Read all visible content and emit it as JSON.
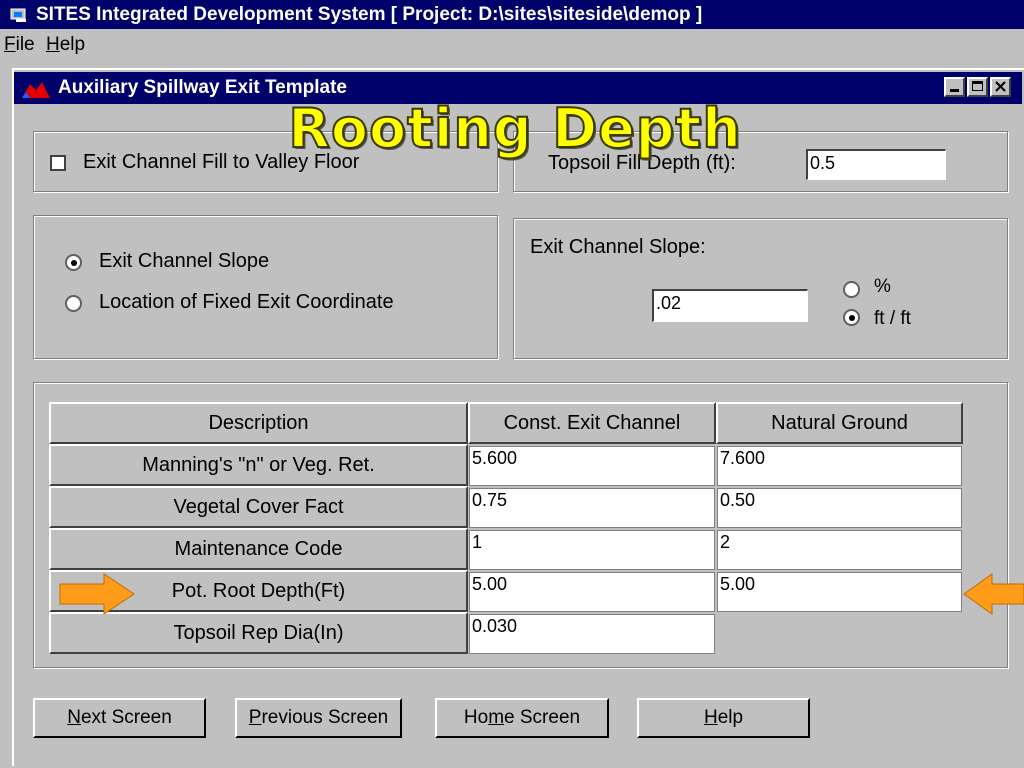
{
  "app": {
    "title": "SITES Integrated Development System [ Project: D:\\sites\\siteside\\demop ]"
  },
  "menu": [
    {
      "label": "File",
      "mnemonic": "F",
      "rest": "ile"
    },
    {
      "label": "Help",
      "mnemonic": "H",
      "rest": "elp"
    }
  ],
  "window": {
    "title": "Auxiliary Spillway Exit Template",
    "controls": [
      "minimize",
      "maximize",
      "close"
    ]
  },
  "overlay": {
    "heading": "Rooting Depth",
    "color": "#ffff00",
    "arrow_color": "#ff9c1a"
  },
  "fill_section": {
    "checkbox_label": "Exit Channel Fill to Valley Floor",
    "checked": false,
    "topsoil_label": "Topsoil Fill Depth (ft):",
    "topsoil_value": "0.5"
  },
  "slope_options": {
    "options": [
      "Exit Channel Slope",
      "Location of Fixed Exit Coordinate"
    ],
    "selected": "Exit Channel Slope"
  },
  "slope_section": {
    "label": "Exit Channel Slope:",
    "value": ".02",
    "units": [
      "%",
      "ft / ft"
    ],
    "selected_unit": "ft / ft"
  },
  "table": {
    "headers": [
      "Description",
      "Const. Exit Channel",
      "Natural Ground"
    ],
    "rows": [
      {
        "description": "Manning's \"n\" or Veg. Ret.",
        "const": "5.600",
        "natural": "7.600"
      },
      {
        "description": "Vegetal Cover Fact",
        "const": "0.75",
        "natural": "0.50"
      },
      {
        "description": "Maintenance Code",
        "const": "1",
        "natural": "2"
      },
      {
        "description": "Pot. Root Depth(Ft)",
        "const": "5.00",
        "natural": "5.00"
      },
      {
        "description": "Topsoil Rep Dia(In)",
        "const": "0.030"
      }
    ]
  },
  "buttons": [
    {
      "label": "Next Screen",
      "mnemonic": "N",
      "rest": "ext Screen",
      "pre": ""
    },
    {
      "label": "Previous Screen",
      "mnemonic": "P",
      "rest": "revious Screen",
      "pre": ""
    },
    {
      "label": "Home Screen",
      "mnemonic": "m",
      "rest": "e Screen",
      "pre": "Ho"
    },
    {
      "label": "Help",
      "mnemonic": "H",
      "rest": "elp",
      "pre": ""
    }
  ]
}
